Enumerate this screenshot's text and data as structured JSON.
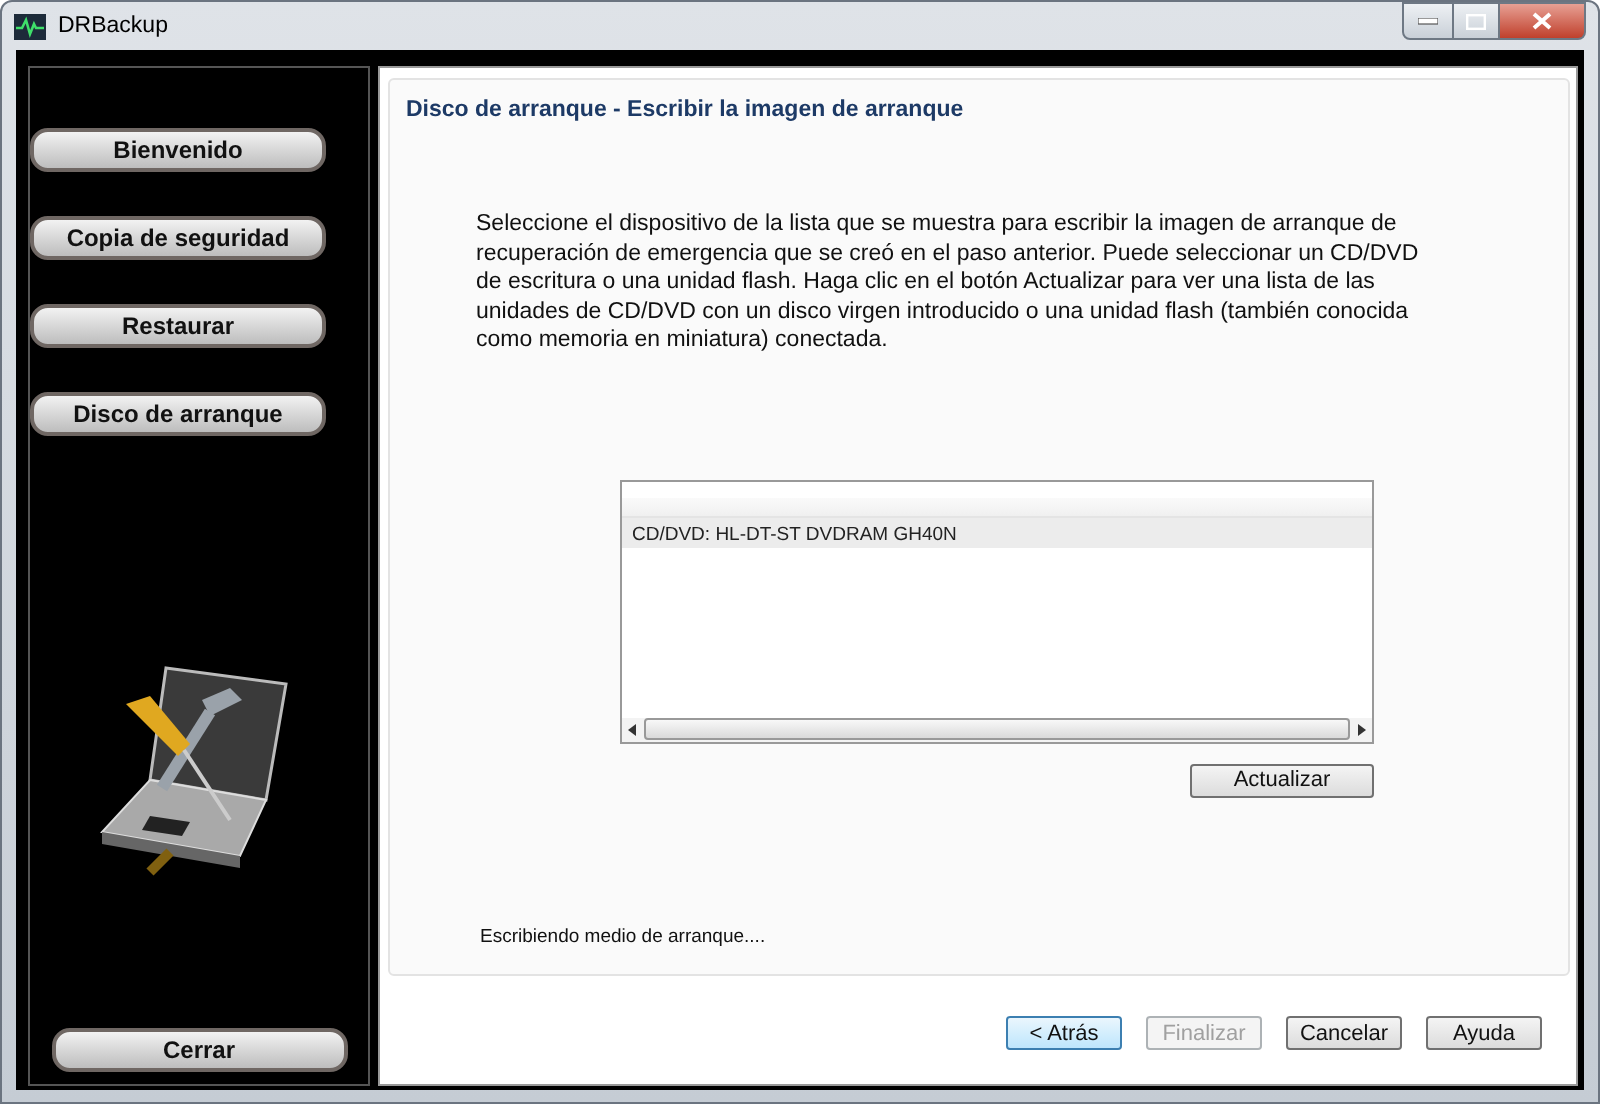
{
  "window": {
    "title": "DRBackup"
  },
  "sidebar": {
    "items": [
      {
        "label": "Bienvenido"
      },
      {
        "label": "Copia de seguridad"
      },
      {
        "label": "Restaurar"
      },
      {
        "label": "Disco de arranque"
      }
    ],
    "close_button": "Cerrar"
  },
  "page": {
    "title": "Disco de arranque - Escribir la imagen de arranque",
    "description": "Seleccione el dispositivo de la lista que se muestra para escribir la imagen de arranque de recuperación de emergencia que se creó en el paso anterior. Puede seleccionar un CD/DVD de escritura o una unidad flash. Haga clic en el botón Actualizar para ver una lista de las unidades de CD/DVD con un disco virgen introducido o una unidad flash (también conocida como memoria en miniatura) conectada.",
    "devices": [
      {
        "label": "CD/DVD: HL-DT-ST DVDRAM GH40N",
        "selected": true
      }
    ],
    "refresh_button": "Actualizar",
    "status": "Escribiendo medio de arranque...."
  },
  "buttons": [
    {
      "label": "< Atrás",
      "default": true,
      "disabled": false
    },
    {
      "label": "Finalizar",
      "default": false,
      "disabled": true
    },
    {
      "label": "Cancelar",
      "default": false,
      "disabled": false
    },
    {
      "label": "Ayuda",
      "default": false,
      "disabled": false
    }
  ]
}
